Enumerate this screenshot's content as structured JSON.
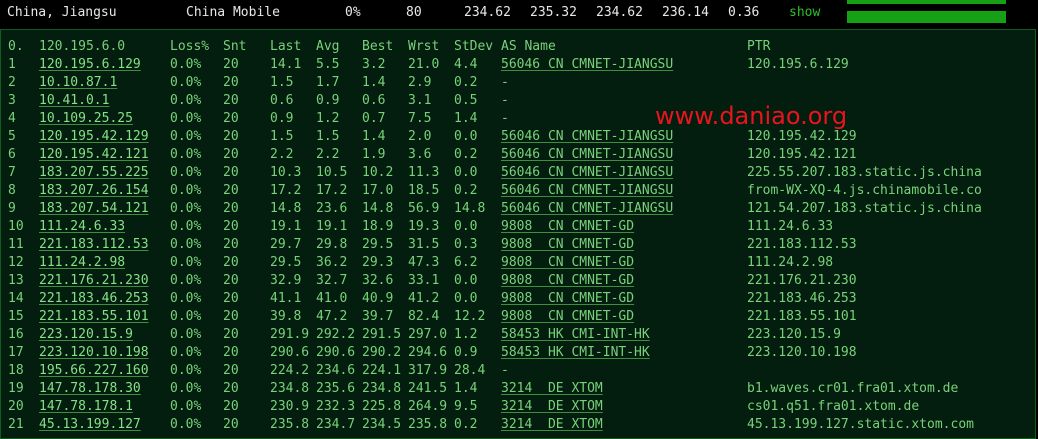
{
  "header": {
    "location": "China, Jiangsu",
    "isp": "China Mobile",
    "loss": "0%",
    "sent": "80",
    "last": "234.62",
    "avg": "235.32",
    "best": "234.62",
    "worst": "236.14",
    "stdev": "0.36",
    "show_label": "show",
    "accent_color": "#15a015"
  },
  "columns": {
    "idx": "0.",
    "host": "120.195.6.0",
    "loss": "Loss%",
    "snt": "Snt",
    "last": "Last",
    "avg": "Avg",
    "best": "Best",
    "wrst": "Wrst",
    "stdev": "StDev",
    "as": "AS Name",
    "ptr": "PTR"
  },
  "rows": [
    {
      "idx": "1",
      "host": "120.195.6.129",
      "loss": "0.0%",
      "snt": "20",
      "last": "14.1",
      "avg": "5.5",
      "best": "3.2",
      "wrst": "21.0",
      "stdev": "4.4",
      "as": "56046 CN CMNET-JIANGSU",
      "ptr": "120.195.6.129"
    },
    {
      "idx": "2",
      "host": "10.10.87.1",
      "loss": "0.0%",
      "snt": "20",
      "last": "1.5",
      "avg": "1.7",
      "best": "1.4",
      "wrst": "2.9",
      "stdev": "0.2",
      "as": "-",
      "ptr": ""
    },
    {
      "idx": "3",
      "host": "10.41.0.1",
      "loss": "0.0%",
      "snt": "20",
      "last": "0.6",
      "avg": "0.9",
      "best": "0.6",
      "wrst": "3.1",
      "stdev": "0.5",
      "as": "-",
      "ptr": ""
    },
    {
      "idx": "4",
      "host": "10.109.25.25",
      "loss": "0.0%",
      "snt": "20",
      "last": "0.9",
      "avg": "1.2",
      "best": "0.7",
      "wrst": "7.5",
      "stdev": "1.4",
      "as": "-",
      "ptr": ""
    },
    {
      "idx": "5",
      "host": "120.195.42.129",
      "loss": "0.0%",
      "snt": "20",
      "last": "1.5",
      "avg": "1.5",
      "best": "1.4",
      "wrst": "2.0",
      "stdev": "0.0",
      "as": "56046 CN CMNET-JIANGSU",
      "ptr": "120.195.42.129"
    },
    {
      "idx": "6",
      "host": "120.195.42.121",
      "loss": "0.0%",
      "snt": "20",
      "last": "2.2",
      "avg": "2.2",
      "best": "1.9",
      "wrst": "3.6",
      "stdev": "0.2",
      "as": "56046 CN CMNET-JIANGSU",
      "ptr": "120.195.42.121"
    },
    {
      "idx": "7",
      "host": "183.207.55.225",
      "loss": "0.0%",
      "snt": "20",
      "last": "10.3",
      "avg": "10.5",
      "best": "10.2",
      "wrst": "11.3",
      "stdev": "0.0",
      "as": "56046 CN CMNET-JIANGSU",
      "ptr": "225.55.207.183.static.js.china"
    },
    {
      "idx": "8",
      "host": "183.207.26.154",
      "loss": "0.0%",
      "snt": "20",
      "last": "17.2",
      "avg": "17.2",
      "best": "17.0",
      "wrst": "18.5",
      "stdev": "0.2",
      "as": "56046 CN CMNET-JIANGSU",
      "ptr": "from-WX-XQ-4.js.chinamobile.co"
    },
    {
      "idx": "9",
      "host": "183.207.54.121",
      "loss": "0.0%",
      "snt": "20",
      "last": "14.8",
      "avg": "23.6",
      "best": "14.8",
      "wrst": "56.9",
      "stdev": "14.8",
      "as": "56046 CN CMNET-JIANGSU",
      "ptr": "121.54.207.183.static.js.china"
    },
    {
      "idx": "10",
      "host": "111.24.6.33",
      "loss": "0.0%",
      "snt": "20",
      "last": "19.1",
      "avg": "19.1",
      "best": "18.9",
      "wrst": "19.3",
      "stdev": "0.0",
      "as": "9808  CN CMNET-GD",
      "ptr": "111.24.6.33"
    },
    {
      "idx": "11",
      "host": "221.183.112.53",
      "loss": "0.0%",
      "snt": "20",
      "last": "29.7",
      "avg": "29.8",
      "best": "29.5",
      "wrst": "31.5",
      "stdev": "0.3",
      "as": "9808  CN CMNET-GD",
      "ptr": "221.183.112.53"
    },
    {
      "idx": "12",
      "host": "111.24.2.98",
      "loss": "0.0%",
      "snt": "20",
      "last": "29.5",
      "avg": "36.2",
      "best": "29.3",
      "wrst": "47.3",
      "stdev": "6.2",
      "as": "9808  CN CMNET-GD",
      "ptr": "111.24.2.98"
    },
    {
      "idx": "13",
      "host": "221.176.21.230",
      "loss": "0.0%",
      "snt": "20",
      "last": "32.9",
      "avg": "32.7",
      "best": "32.6",
      "wrst": "33.1",
      "stdev": "0.0",
      "as": "9808  CN CMNET-GD",
      "ptr": "221.176.21.230"
    },
    {
      "idx": "14",
      "host": "221.183.46.253",
      "loss": "0.0%",
      "snt": "20",
      "last": "41.1",
      "avg": "41.0",
      "best": "40.9",
      "wrst": "41.2",
      "stdev": "0.0",
      "as": "9808  CN CMNET-GD",
      "ptr": "221.183.46.253"
    },
    {
      "idx": "15",
      "host": "221.183.55.101",
      "loss": "0.0%",
      "snt": "20",
      "last": "39.8",
      "avg": "47.2",
      "best": "39.7",
      "wrst": "82.4",
      "stdev": "12.2",
      "as": "9808  CN CMNET-GD",
      "ptr": "221.183.55.101"
    },
    {
      "idx": "16",
      "host": "223.120.15.9",
      "loss": "0.0%",
      "snt": "20",
      "last": "291.9",
      "avg": "292.2",
      "best": "291.5",
      "wrst": "297.0",
      "stdev": "1.2",
      "as": "58453 HK CMI-INT-HK",
      "ptr": "223.120.15.9"
    },
    {
      "idx": "17",
      "host": "223.120.10.198",
      "loss": "0.0%",
      "snt": "20",
      "last": "290.6",
      "avg": "290.6",
      "best": "290.2",
      "wrst": "294.6",
      "stdev": "0.9",
      "as": "58453 HK CMI-INT-HK",
      "ptr": "223.120.10.198"
    },
    {
      "idx": "18",
      "host": "195.66.227.160",
      "loss": "0.0%",
      "snt": "20",
      "last": "224.2",
      "avg": "234.6",
      "best": "224.1",
      "wrst": "317.9",
      "stdev": "28.4",
      "as": "-",
      "ptr": ""
    },
    {
      "idx": "19",
      "host": "147.78.178.30",
      "loss": "0.0%",
      "snt": "20",
      "last": "234.8",
      "avg": "235.6",
      "best": "234.8",
      "wrst": "241.5",
      "stdev": "1.4",
      "as": "3214  DE XTOM",
      "ptr": "b1.waves.cr01.fra01.xtom.de"
    },
    {
      "idx": "20",
      "host": "147.78.178.1",
      "loss": "0.0%",
      "snt": "20",
      "last": "230.9",
      "avg": "232.3",
      "best": "225.8",
      "wrst": "264.9",
      "stdev": "9.5",
      "as": "3214  DE XTOM",
      "ptr": "cs01.q51.fra01.xtom.de"
    },
    {
      "idx": "21",
      "host": "45.13.199.127",
      "loss": "0.0%",
      "snt": "20",
      "last": "235.8",
      "avg": "234.7",
      "best": "234.5",
      "wrst": "235.8",
      "stdev": "0.2",
      "as": "3214  DE XTOM",
      "ptr": "45.13.199.127.static.xtom.com"
    }
  ],
  "watermark": "www.daniao.org"
}
